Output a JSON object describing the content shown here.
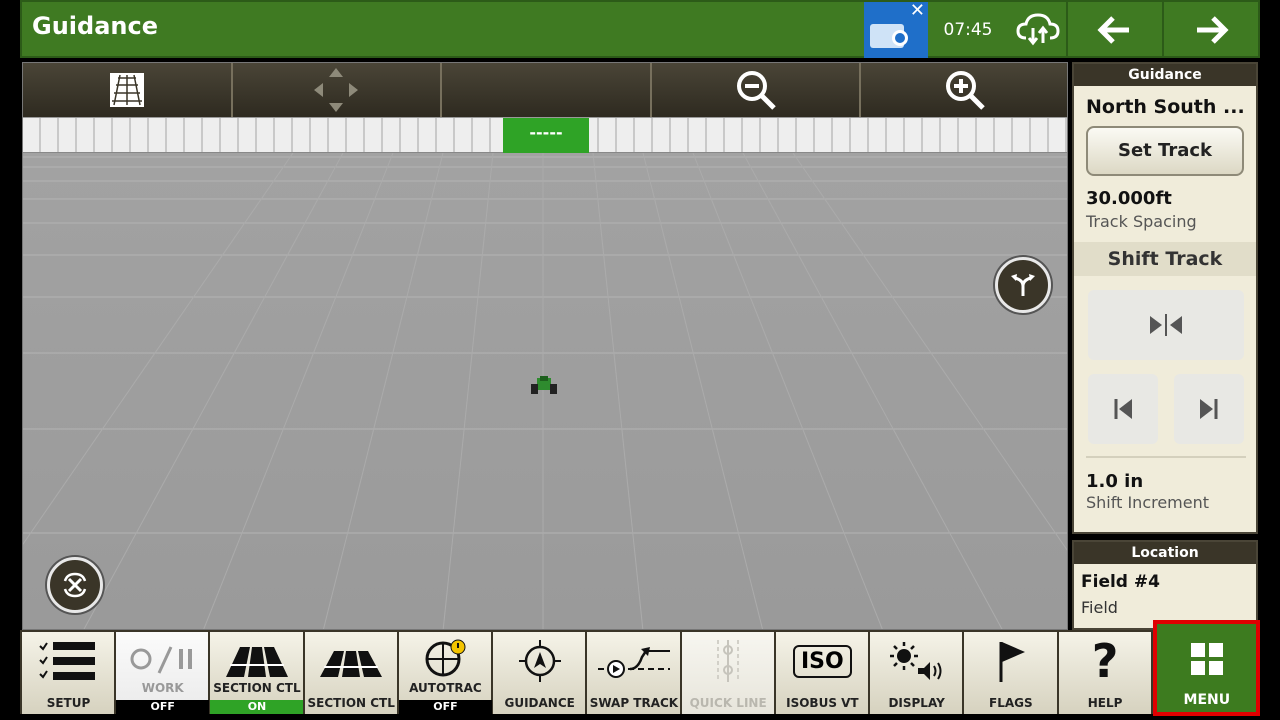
{
  "header": {
    "title": "Guidance",
    "time": "07:45",
    "operator_icon": "operator-card-icon",
    "cloud_icon": "cloud-sync-icon",
    "back_icon": "arrow-left-icon",
    "forward_icon": "arrow-right-icon"
  },
  "map_toolbar": {
    "buttons": [
      {
        "icon": "view-perspective-icon"
      },
      {
        "icon": "pan-arrows-icon"
      },
      {
        "icon": "blank"
      },
      {
        "icon": "zoom-out-icon"
      },
      {
        "icon": "zoom-in-icon"
      }
    ]
  },
  "lightbar": {
    "center_text": "-----"
  },
  "guidance_panel": {
    "header": "Guidance",
    "track_name": "North South ...",
    "set_track_label": "Set Track",
    "track_spacing_value": "30.000ft",
    "track_spacing_label": "Track Spacing",
    "shift_track_header": "Shift Track",
    "shift_increment_value": "1.0 in",
    "shift_increment_label": "Shift Increment"
  },
  "location_panel": {
    "header": "Location",
    "field_name": "Field #4",
    "field_label": "Field"
  },
  "shortcuts": [
    {
      "label": "SETUP",
      "icon": "checklist-icon"
    },
    {
      "label": "WORK",
      "status": "OFF",
      "icon": "record-pause-icon"
    },
    {
      "label": "SECTION CTL",
      "status": "ON",
      "icon": "section-control-icon"
    },
    {
      "label": "SECTION CTL",
      "icon": "section-control-icon"
    },
    {
      "label": "AUTOTRAC",
      "status": "OFF",
      "icon": "autotrac-steering-icon"
    },
    {
      "label": "GUIDANCE",
      "icon": "guidance-target-icon"
    },
    {
      "label": "SWAP TRACK",
      "icon": "swap-track-icon"
    },
    {
      "label": "QUICK LINE",
      "icon": "quick-line-icon",
      "disabled": true
    },
    {
      "label": "ISOBUS VT",
      "icon": "iso-icon",
      "icon_text": "ISO"
    },
    {
      "label": "DISPLAY",
      "icon": "brightness-volume-icon"
    },
    {
      "label": "FLAGS",
      "icon": "flag-icon"
    },
    {
      "label": "HELP",
      "icon": "help-icon",
      "icon_text": "?"
    },
    {
      "label": "MENU",
      "icon": "menu-grid-icon"
    }
  ],
  "colors": {
    "header_green": "#3f7a22",
    "lightbar_green": "#2fa326",
    "panel_dark": "#3a3528",
    "panel_bg": "#f0ecda",
    "highlight_red": "#e00000"
  }
}
